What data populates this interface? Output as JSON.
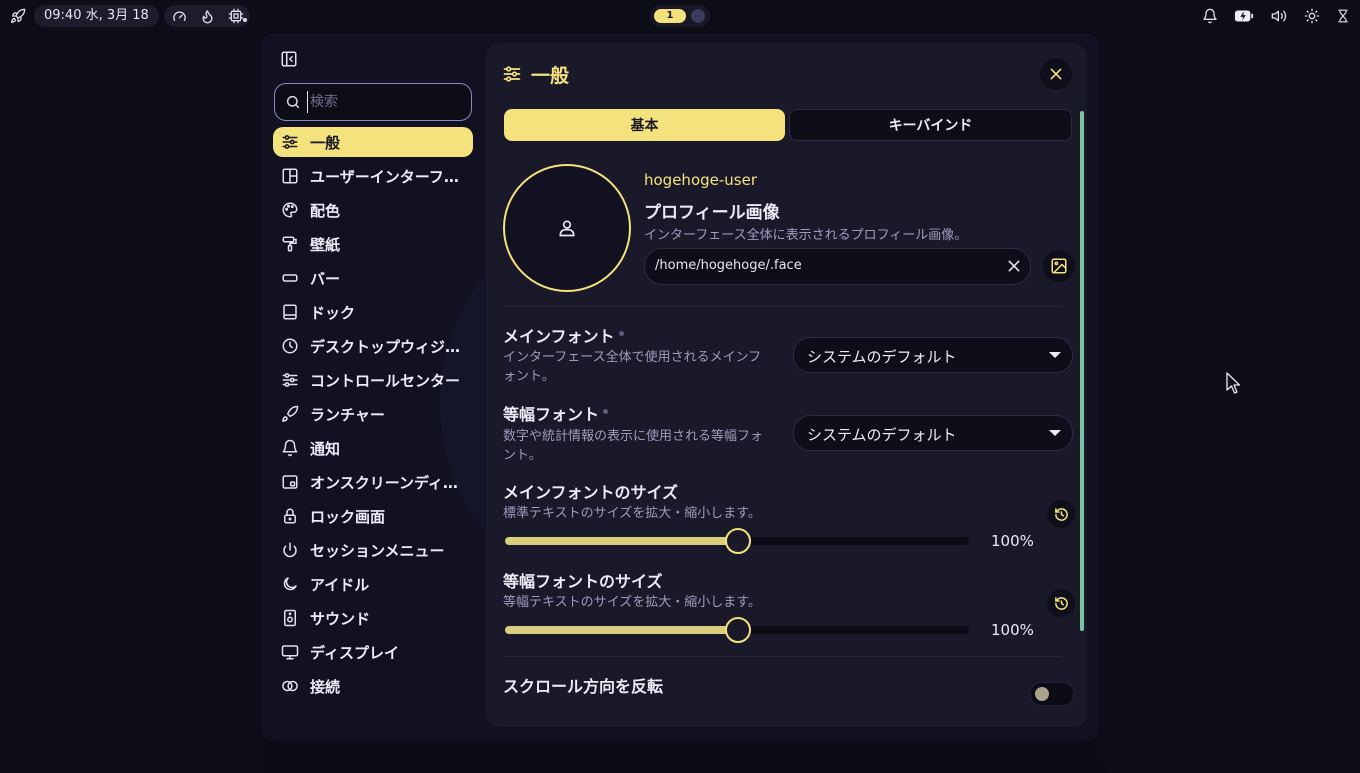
{
  "topbar": {
    "clock": "09:40 水, 3月 18",
    "workspace_active": "1",
    "icons_left": [
      "rocket-icon",
      "gauge-icon",
      "flame-icon",
      "cpu-icon"
    ],
    "icons_right": [
      "bell-icon",
      "battery-icon",
      "volume-icon",
      "brightness-icon",
      "hourglass-icon"
    ]
  },
  "sidebar": {
    "search_placeholder": "検索",
    "items": [
      {
        "label": "一般",
        "icon": "sliders-icon"
      },
      {
        "label": "ユーザーインターフェース",
        "icon": "layout-icon"
      },
      {
        "label": "配色",
        "icon": "palette-icon"
      },
      {
        "label": "壁紙",
        "icon": "paint-roller-icon"
      },
      {
        "label": "バー",
        "icon": "bar-icon"
      },
      {
        "label": "ドック",
        "icon": "dock-icon"
      },
      {
        "label": "デスクトップウィジェット",
        "icon": "clock-icon"
      },
      {
        "label": "コントロールセンター",
        "icon": "sliders-icon"
      },
      {
        "label": "ランチャー",
        "icon": "rocket-icon"
      },
      {
        "label": "通知",
        "icon": "bell-icon"
      },
      {
        "label": "オンスクリーンディスプレイ",
        "icon": "osd-icon"
      },
      {
        "label": "ロック画面",
        "icon": "lock-icon"
      },
      {
        "label": "セッションメニュー",
        "icon": "power-icon"
      },
      {
        "label": "アイドル",
        "icon": "moon-icon"
      },
      {
        "label": "サウンド",
        "icon": "speaker-icon"
      },
      {
        "label": "ディスプレイ",
        "icon": "monitor-icon"
      },
      {
        "label": "接続",
        "icon": "link-icon"
      }
    ]
  },
  "main": {
    "title": "一般",
    "tabs": [
      {
        "label": "基本",
        "active": true
      },
      {
        "label": "キーバインド",
        "active": false
      }
    ],
    "profile": {
      "username": "hogehoge-user",
      "title": "プロフィール画像",
      "description": "インターフェース全体に表示されるプロフィール画像。",
      "path": "/home/hogehoge/.face"
    },
    "main_font": {
      "title": "メインフォント",
      "description": "インターフェース全体で使用されるメインフォント。",
      "value": "システムのデフォルト"
    },
    "mono_font": {
      "title": "等幅フォント",
      "description": "数字や統計情報の表示に使用される等幅フォント。",
      "value": "システムのデフォルト"
    },
    "main_font_size": {
      "title": "メインフォントのサイズ",
      "description": "標準テキストのサイズを拡大・縮小します。",
      "value_label": "100%",
      "level": 0.5
    },
    "mono_font_size": {
      "title": "等幅フォントのサイズ",
      "description": "等幅テキストのサイズを拡大・縮小します。",
      "value_label": "100%",
      "level": 0.5
    },
    "scroll_invert": {
      "title": "スクロール方向を反転",
      "enabled": false
    }
  },
  "colors": {
    "accent": "#f4e27d",
    "background": "#0c0c17",
    "card": "#191929",
    "scrollbar": "#7fc3a3"
  }
}
